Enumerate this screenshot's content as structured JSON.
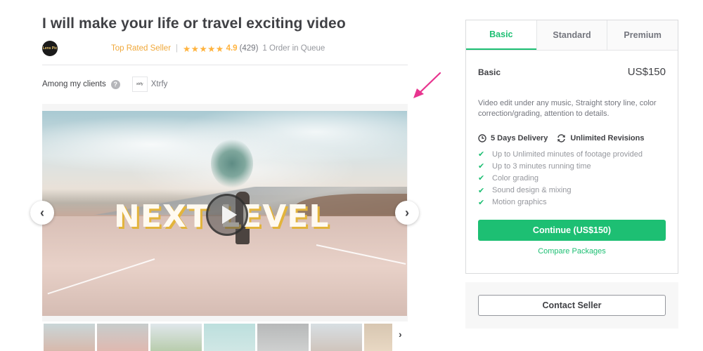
{
  "gig": {
    "title": "I will make your life or travel exciting video",
    "seller": {
      "avatar_text": "Lens Pic",
      "level": "Top Rated Seller",
      "stars": "★★★★★",
      "rating": "4.9",
      "reviews": "(429)",
      "queue": "1 Order in Queue"
    },
    "clients": {
      "label": "Among my clients",
      "help_icon": "?",
      "logo_text": "xtrfy",
      "name": "Xtrfy"
    }
  },
  "gallery": {
    "overlay_text": "NEXT LEVEL",
    "prev_icon": "‹",
    "next_icon": "›",
    "thumbs_next_icon": "›",
    "thumbnails": [
      {
        "colors": [
          "#c9d6d8",
          "#d8b9ac"
        ],
        "active": true
      },
      {
        "colors": [
          "#9aa3a2",
          "#c57f6f"
        ],
        "active": false
      },
      {
        "colors": [
          "#c6d3db",
          "#7fa36a"
        ],
        "active": false
      },
      {
        "colors": [
          "#86c5c2",
          "#a9d3cf"
        ],
        "active": false
      },
      {
        "colors": [
          "#7c7f80",
          "#a7a9a8"
        ],
        "active": false
      },
      {
        "colors": [
          "#b7c4cc",
          "#a99587"
        ],
        "active": false
      },
      {
        "colors": [
          "#b79872",
          "#d6b892"
        ],
        "active": false
      }
    ]
  },
  "packages": {
    "tabs": [
      {
        "label": "Basic",
        "active": true
      },
      {
        "label": "Standard",
        "active": false
      },
      {
        "label": "Premium",
        "active": false
      }
    ],
    "selected": {
      "name": "Basic",
      "price": "US$150",
      "description": "Video edit under any music, Straight story line, color correction/grading, attention to details.",
      "delivery": "5 Days Delivery",
      "revisions": "Unlimited Revisions",
      "features": [
        "Up to Unlimited minutes of footage provided",
        "Up to 3 minutes running time",
        "Color grading",
        "Sound design & mixing",
        "Motion graphics"
      ],
      "check_icon": "✔",
      "continue_label": "Continue (US$150)",
      "compare_label": "Compare Packages"
    }
  },
  "contact": {
    "button_label": "Contact Seller"
  },
  "colors": {
    "accent": "#1dbf73",
    "star": "#ffb33e",
    "annotation_arrow": "#e8348f"
  }
}
